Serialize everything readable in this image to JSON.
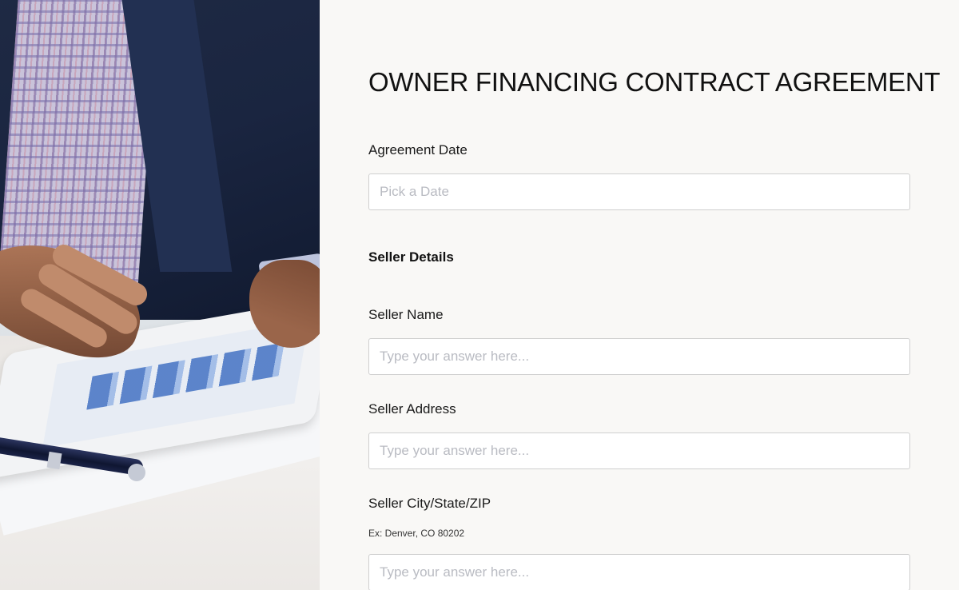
{
  "form": {
    "title": "OWNER FINANCING CONTRACT AGREEMENT",
    "agreement_date": {
      "label": "Agreement Date",
      "placeholder": "Pick a Date",
      "value": ""
    },
    "seller_section": "Seller Details",
    "seller_name": {
      "label": "Seller Name",
      "placeholder": "Type your answer here...",
      "value": ""
    },
    "seller_address": {
      "label": "Seller Address",
      "placeholder": "Type your answer here...",
      "value": ""
    },
    "seller_city": {
      "label": "Seller City/State/ZIP",
      "hint": "Ex: Denver, CO 80202",
      "placeholder": "Type your answer here...",
      "value": ""
    }
  },
  "colors": {
    "background": "#f9f8f6",
    "text": "#111111",
    "input_border": "#cfcfcf",
    "placeholder": "#b9bbc2"
  }
}
